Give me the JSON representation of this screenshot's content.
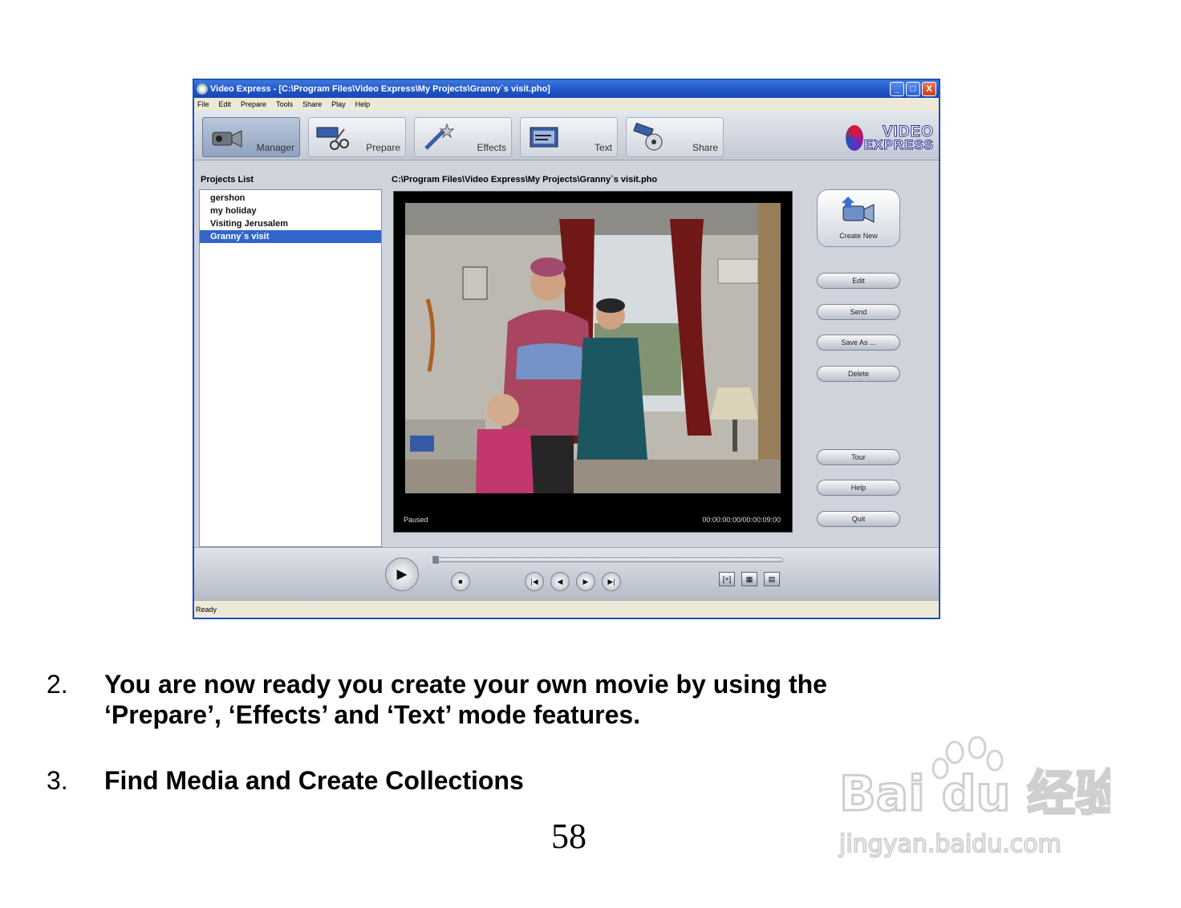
{
  "window": {
    "title": "Video Express - [C:\\Program Files\\Video Express\\My Projects\\Granny`s visit.pho]",
    "controls": [
      "_",
      "□",
      "X"
    ],
    "menu": [
      "File",
      "Edit",
      "Prepare",
      "Tools",
      "Share",
      "Play",
      "Help"
    ],
    "modes": [
      {
        "label": "Manager",
        "icon": "camcorder-icon",
        "active": true
      },
      {
        "label": "Prepare",
        "icon": "scissors-film-icon",
        "active": false
      },
      {
        "label": "Effects",
        "icon": "magic-wand-icon",
        "active": false
      },
      {
        "label": "Text",
        "icon": "text-film-icon",
        "active": false
      },
      {
        "label": "Share",
        "icon": "share-reel-icon",
        "active": false
      }
    ],
    "logo": {
      "line1": "VIDEO",
      "line2": "EXPRESS"
    },
    "projects_label": "Projects List",
    "projects": [
      "gershon",
      "my holiday",
      "Visiting Jerusalem",
      "Granny`s visit"
    ],
    "selected_project": "Granny`s visit",
    "current_path": "C:\\Program Files\\Video Express\\My Projects\\Granny`s visit.pho",
    "player_status": "Paused",
    "timecode": "00:00:00:00/00:00:09:00",
    "create_new_label": "Create New",
    "side_buttons": [
      "Edit",
      "Send",
      "Save As ...",
      "Delete",
      "Tour",
      "Help",
      "Quit"
    ],
    "transport": {
      "play": "▶",
      "stop": "■",
      "skip": [
        "|◀",
        "◀",
        "▶",
        "▶|"
      ],
      "view": [
        "[+]",
        "▦",
        "▤"
      ]
    },
    "statusbar": "Ready"
  },
  "steps": [
    {
      "number": "2.",
      "text_line1": "You are now ready you create your own movie by using the",
      "text_line2": "‘Prepare’, ‘Effects’ and ‘Text’ mode features."
    },
    {
      "number": "3.",
      "text_line1": "Find Media and Create Collections"
    }
  ],
  "page_number": "58",
  "watermark": {
    "brand": "Bai du 经验",
    "url": "jingyan.baidu.com"
  },
  "colors": {
    "title_bar": "#1f53c6",
    "selection": "#3166cc",
    "logo_red": "#e5122b",
    "logo_blue": "#2a2f8a"
  }
}
